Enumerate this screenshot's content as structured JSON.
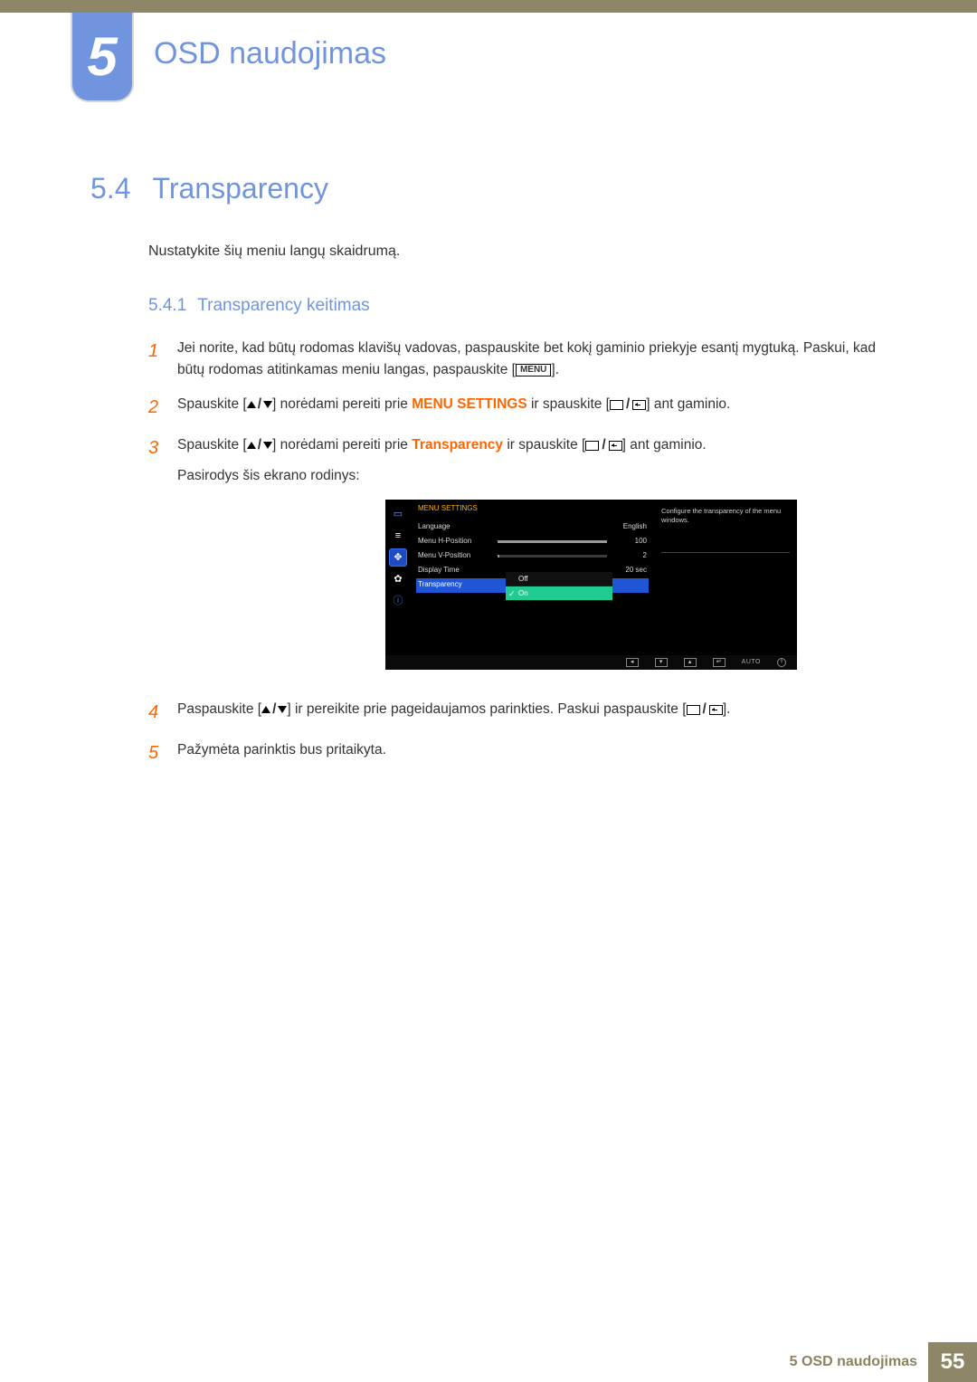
{
  "header": {
    "chapter_number": "5",
    "chapter_title": "OSD naudojimas"
  },
  "section": {
    "number": "5.4",
    "title": "Transparency",
    "intro": "Nustatykite šių meniu langų skaidrumą."
  },
  "subsection": {
    "number": "5.4.1",
    "title": "Transparency keitimas"
  },
  "steps": {
    "s1a": "Jei norite, kad būtų rodomas klavišų vadovas, paspauskite bet kokį gaminio priekyje esantį mygtuką. Paskui, kad būtų rodomas atitinkamas meniu langas, paspauskite [",
    "s1b": "].",
    "s2a": "Spauskite [",
    "s2b": "] norėdami pereiti prie ",
    "s2_kw": "MENU SETTINGS",
    "s2c": " ir spauskite [",
    "s2d": "] ant gaminio.",
    "s3a": "Spauskite [",
    "s3b": "] norėdami pereiti prie ",
    "s3_kw": "Transparency",
    "s3c": " ir spauskite [",
    "s3d": "] ant gaminio.",
    "s3_after": "Pasirodys šis ekrano rodinys:",
    "s4a": "Paspauskite [",
    "s4b": "] ir pereikite prie pageidaujamos parinkties. Paskui paspauskite [",
    "s4c": "].",
    "s5": "Pažymėta parinktis bus pritaikyta."
  },
  "ui": {
    "menu_label": "MENU"
  },
  "osd": {
    "title": "MENU SETTINGS",
    "rows": {
      "language": {
        "label": "Language",
        "value": "English"
      },
      "hpos": {
        "label": "Menu H-Position",
        "value": "100",
        "fill": 100
      },
      "vpos": {
        "label": "Menu V-Position",
        "value": "2",
        "fill": 2
      },
      "displaytime": {
        "label": "Display Time",
        "value": "20 sec"
      },
      "transparency": {
        "label": "Transparency"
      }
    },
    "options": {
      "off": "Off",
      "on": "On"
    },
    "description": "Configure the transparency of the menu windows.",
    "nav": {
      "auto": "AUTO"
    }
  },
  "footer": {
    "text": "5 OSD naudojimas",
    "page": "55"
  }
}
